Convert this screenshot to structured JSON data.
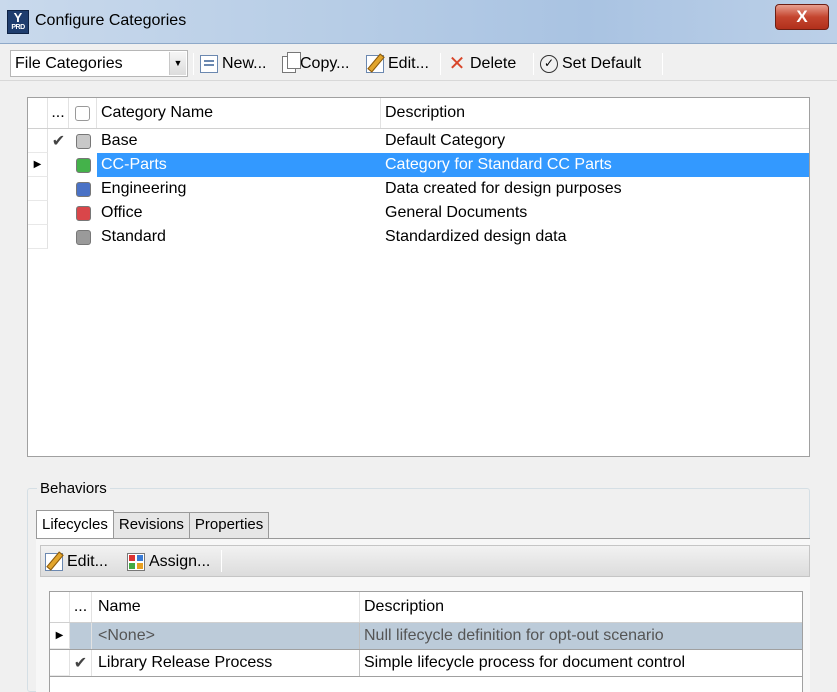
{
  "window": {
    "title": "Configure Categories",
    "icon": "yprd-app-icon",
    "close_label": "X"
  },
  "toolbar": {
    "category_type": "File Categories",
    "buttons": [
      {
        "label": "New...",
        "icon": "new-icon"
      },
      {
        "label": "Copy...",
        "icon": "copy-icon"
      },
      {
        "label": "Edit...",
        "icon": "edit-icon"
      },
      {
        "label": "Delete",
        "icon": "delete-icon"
      },
      {
        "label": "Set Default",
        "icon": "set-default-icon"
      }
    ]
  },
  "categories": {
    "headers": {
      "gutter": "...",
      "name": "Category Name",
      "description": "Description"
    },
    "rows": [
      {
        "default": "✔",
        "color": "#c8c8c8",
        "name": "Base",
        "description": "Default Category"
      },
      {
        "default": "",
        "color": "#44b24a",
        "name": "CC-Parts",
        "description": "Category for Standard CC Parts",
        "selected": true
      },
      {
        "default": "",
        "color": "#4a72c6",
        "name": "Engineering",
        "description": "Data created for design purposes"
      },
      {
        "default": "",
        "color": "#d9464a",
        "name": "Office",
        "description": "General Documents"
      },
      {
        "default": "",
        "color": "#9a9a9a",
        "name": "Standard",
        "description": "Standardized design data"
      }
    ]
  },
  "behaviors": {
    "label": "Behaviors",
    "tabs": [
      "Lifecycles",
      "Revisions",
      "Properties"
    ],
    "active_tab": "Lifecycles",
    "subtoolbar": {
      "edit": "Edit...",
      "assign": "Assign..."
    },
    "lifecycles": {
      "headers": {
        "gutter": "...",
        "name": "Name",
        "description": "Description"
      },
      "rows": [
        {
          "default": "",
          "name": "<None>",
          "description": "Null lifecycle definition for opt-out scenario",
          "selected": true
        },
        {
          "default": "✔",
          "name": "Library Release Process",
          "description": "Simple lifecycle process for document control"
        }
      ]
    }
  }
}
